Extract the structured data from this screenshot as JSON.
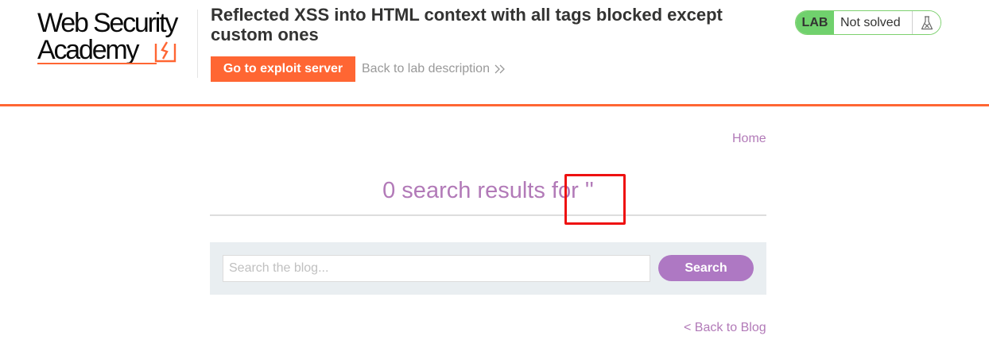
{
  "header": {
    "logo": {
      "line1": "Web Security",
      "line2": "Academy"
    },
    "lab_title": "Reflected XSS into HTML context with all tags blocked except custom ones",
    "exploit_button": "Go to exploit server",
    "back_to_description": "Back to lab description",
    "status": {
      "badge": "LAB",
      "text": "Not solved",
      "icon": "flask-icon"
    },
    "colors": {
      "accent": "#ff6633",
      "status_green": "#70d16d"
    }
  },
  "nav": {
    "home": "Home"
  },
  "main": {
    "results_heading": "0 search results for ''",
    "search": {
      "placeholder": "Search the blog...",
      "value": "",
      "button": "Search"
    },
    "back_to_blog": "< Back to Blog",
    "colors": {
      "link": "#b27ab8",
      "button": "#ae78c3",
      "panel": "#e9eef1"
    }
  }
}
